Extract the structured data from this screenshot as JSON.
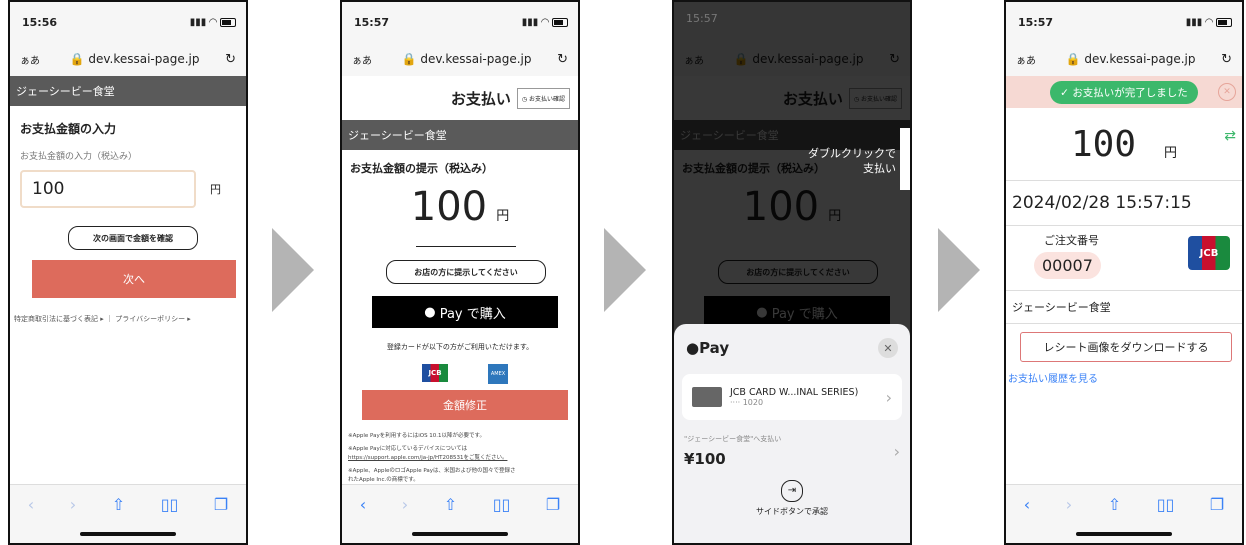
{
  "common": {
    "url": "dev.kessai-page.jp",
    "aa": "ぁあ",
    "merchant": "ジェーシービー食堂",
    "amount": "100",
    "yen": "円"
  },
  "screen1": {
    "time": "15:56",
    "title": "お支払金額の入力",
    "input_label": "お支払金額の入力（税込み）",
    "input_value": "100",
    "hint": "次の画面で金額を確認",
    "next": "次へ",
    "footer_link1": "特定商取引法に基づく表記",
    "footer_link2": "プライバシーポリシー"
  },
  "screen2": {
    "time": "15:57",
    "heading": "お支払い",
    "confirm_btn": "お支払い確認",
    "present_title": "お支払金額の提示（税込み）",
    "bubble": "お店の方に提示してください",
    "apple_pay": "Pay で購入",
    "cards_note": "登録カードが以下の方がご利用いただけます。",
    "jcb": "JCB",
    "amex": "AMEX",
    "fix_btn": "金額修正",
    "note1": "※Apple Payを利用するにはiOS 10.1以降が必要です。",
    "note2": "※Apple Payに対応しているデバイスについては",
    "note2_link": "https://support.apple.com/ja-jp/HT208531をご覧ください。",
    "note3": "※Apple、AppleのロゴApple Payは、米国および他の国々で登録さ",
    "note4": "れたApple Inc.の商標です。"
  },
  "screen3": {
    "double_click": "ダブルクリックで",
    "pay_label": "支払い",
    "sheet_title": "Pay",
    "card_name": "JCB CARD W...INAL SERIES)",
    "card_num": "···· 1020",
    "pay_to": "\"ジェーシービー食堂\"へ支払い",
    "total": "¥100",
    "side_btn": "サイドボタンで承認"
  },
  "screen4": {
    "time": "15:57",
    "complete": "お支払いが完了しました",
    "datetime": "2024/02/28 15:57:15",
    "order_label": "ご注文番号",
    "order_no": "00007",
    "receipt_btn": "レシート画像をダウンロードする",
    "history": "お支払い履歴を見る"
  }
}
